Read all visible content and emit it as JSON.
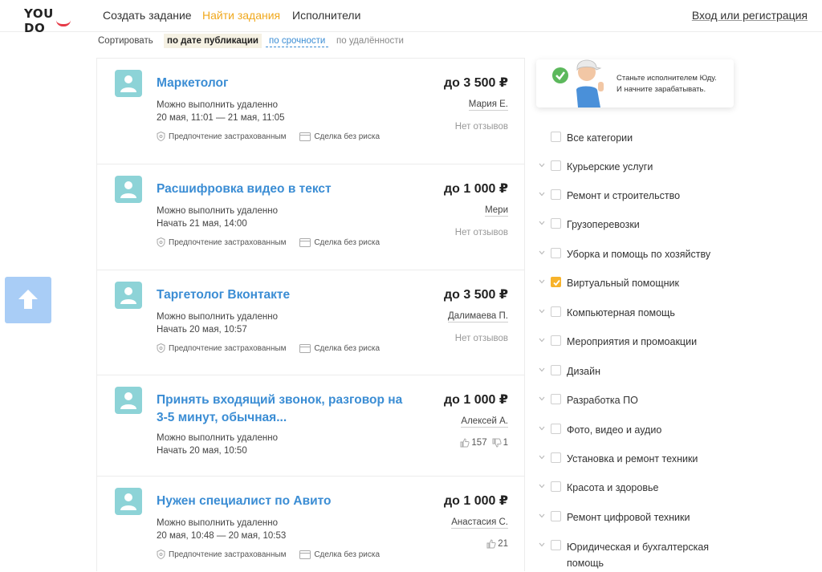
{
  "header": {
    "logo": "YOU DO",
    "nav": [
      {
        "label": "Создать задание",
        "active": false
      },
      {
        "label": "Найти задания",
        "active": true
      },
      {
        "label": "Исполнители",
        "active": false
      }
    ],
    "login": "Вход или регистрация"
  },
  "sort": {
    "label": "Сортировать",
    "options": [
      {
        "label": "по дате публикации",
        "state": "selected"
      },
      {
        "label": "по срочности",
        "state": "link"
      },
      {
        "label": "по удалённости",
        "state": "plain"
      }
    ]
  },
  "scroll_up": {
    "icon": "arrow-up-icon"
  },
  "tasks": [
    {
      "title": "Маркетолог",
      "price": "до 3 500 ₽",
      "location": "Можно выполнить удаленно",
      "time": "20 мая, 11:01 — 21 мая, 11:05",
      "author": "Мария Е.",
      "reviews": "Нет отзывов",
      "tags": [
        "Предпочтение застрахованным",
        "Сделка без риска"
      ]
    },
    {
      "title": "Расшифровка видео в текст",
      "price": "до 1 000 ₽",
      "location": "Можно выполнить удаленно",
      "time": "Начать 21 мая, 14:00",
      "author": "Мери",
      "reviews": "Нет отзывов",
      "tags": [
        "Предпочтение застрахованным",
        "Сделка без риска"
      ]
    },
    {
      "title": "Таргетолог Вконтакте",
      "price": "до 3 500 ₽",
      "location": "Можно выполнить удаленно",
      "time": "Начать 20 мая, 10:57",
      "author": "Далимаева П.",
      "reviews": "Нет отзывов",
      "tags": [
        "Предпочтение застрахованным",
        "Сделка без риска"
      ]
    },
    {
      "title": "Принять входящий звонок, разговор на 3-5 минут, обычная...",
      "price": "до 1 000 ₽",
      "location": "Можно выполнить удаленно",
      "time": "Начать 20 мая, 10:50",
      "author": "Алексей А.",
      "likes": "157",
      "dislikes": "1"
    },
    {
      "title": "Нужен специалист по Авито",
      "price": "до 1 000 ₽",
      "location": "Можно выполнить удаленно",
      "time": "20 мая, 10:48 — 20 мая, 10:53",
      "author": "Анастасия С.",
      "likes": "21",
      "tags": [
        "Предпочтение застрахованным",
        "Сделка без риска"
      ]
    }
  ],
  "promo": {
    "line1": "Станьте исполнителем Юду.",
    "line2": "И начните зарабатывать."
  },
  "categories": [
    {
      "label": "Все категории",
      "checked": false,
      "expandable": false
    },
    {
      "label": "Курьерские услуги",
      "checked": false,
      "expandable": true
    },
    {
      "label": "Ремонт и строительство",
      "checked": false,
      "expandable": true
    },
    {
      "label": "Грузоперевозки",
      "checked": false,
      "expandable": true
    },
    {
      "label": "Уборка и помощь по хозяйству",
      "checked": false,
      "expandable": true
    },
    {
      "label": "Виртуальный помощник",
      "checked": true,
      "expandable": true
    },
    {
      "label": "Компьютерная помощь",
      "checked": false,
      "expandable": true
    },
    {
      "label": "Мероприятия и промоакции",
      "checked": false,
      "expandable": true
    },
    {
      "label": "Дизайн",
      "checked": false,
      "expandable": true
    },
    {
      "label": "Разработка ПО",
      "checked": false,
      "expandable": true
    },
    {
      "label": "Фото, видео и аудио",
      "checked": false,
      "expandable": true
    },
    {
      "label": "Установка и ремонт техники",
      "checked": false,
      "expandable": true
    },
    {
      "label": "Красота и здоровье",
      "checked": false,
      "expandable": true
    },
    {
      "label": "Ремонт цифровой техники",
      "checked": false,
      "expandable": true
    },
    {
      "label": "Юридическая и бухгалтерская помощь",
      "checked": false,
      "expandable": true
    }
  ],
  "colors": {
    "accent": "#f0a81d",
    "link": "#3b8dd4",
    "avatar": "#8dd3d7",
    "scroll_button": "#a9cdf6",
    "checkbox_checked": "#f7b32b"
  }
}
